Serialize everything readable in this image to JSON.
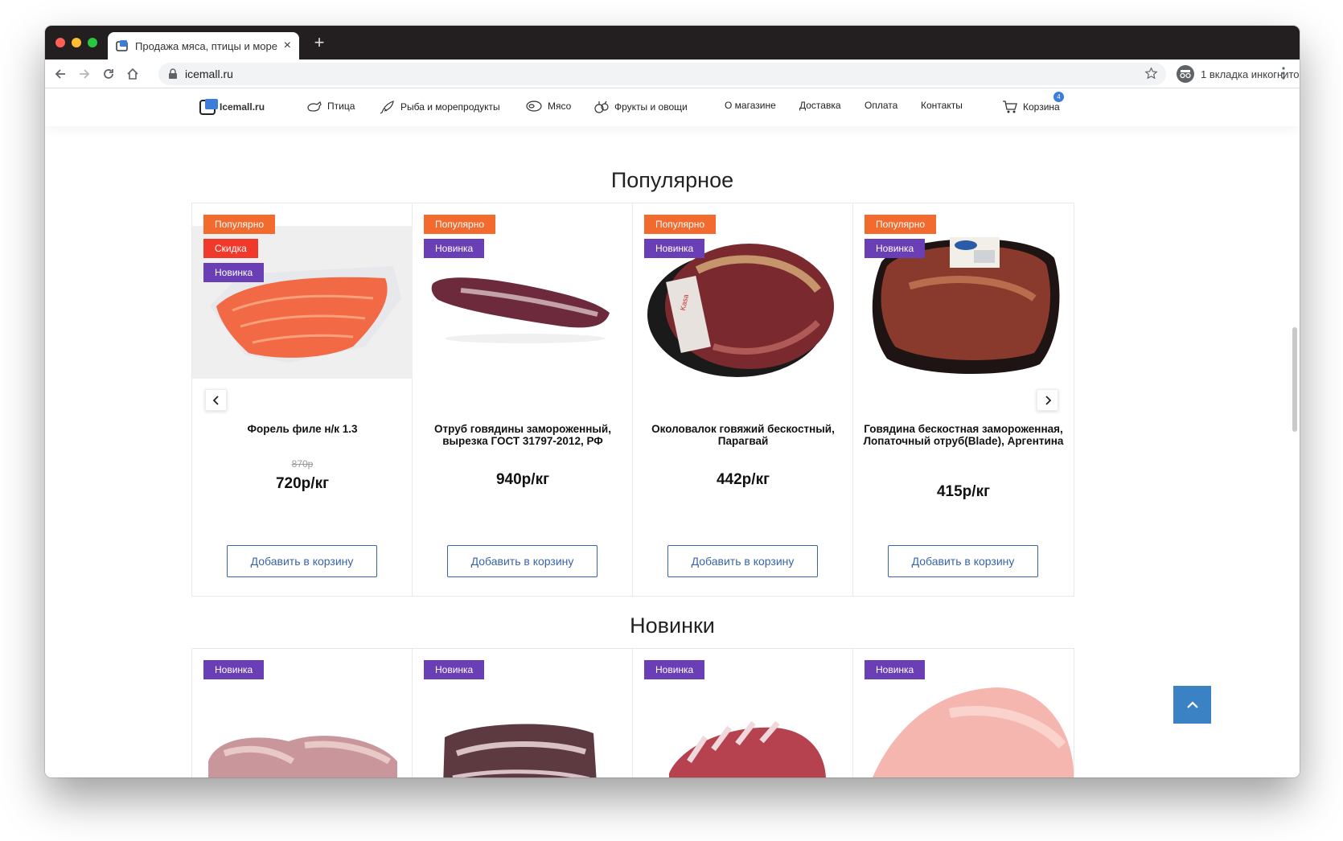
{
  "browser": {
    "tab_title": "Продажа мяса, птицы и море",
    "tab_close": "×",
    "new_tab": "+",
    "url": "icemall.ru",
    "incognito_label": "1 вкладка инкогнито"
  },
  "site": {
    "logo_text": "Icemall.ru",
    "nav": [
      {
        "label": "Птица",
        "icon": "poultry-icon"
      },
      {
        "label": "Рыба и морепродукты",
        "icon": "fish-icon"
      },
      {
        "label": "Мясо",
        "icon": "meat-icon"
      },
      {
        "label": "Фрукты и овощи",
        "icon": "fruits-icon"
      },
      {
        "label": "О магазине"
      },
      {
        "label": "Доставка"
      },
      {
        "label": "Оплата"
      },
      {
        "label": "Контакты"
      }
    ],
    "cart_label": "Корзина",
    "cart_count": "4"
  },
  "popular": {
    "title": "Популярное",
    "products": [
      {
        "name": "Форель филе н/к 1.3",
        "old_price": "870р",
        "price": "720р/кг",
        "badges": [
          "Популярно",
          "Скидка",
          "Новинка"
        ],
        "button": "Добавить в корзину"
      },
      {
        "name": "Отруб говядины замороженный, вырезка ГОСТ 31797-2012, РФ",
        "price": "940р/кг",
        "badges": [
          "Популярно",
          "Новинка"
        ],
        "button": "Добавить в корзину"
      },
      {
        "name": "Околовалок говяжий бескостный, Парагвай",
        "price": "442р/кг",
        "badges": [
          "Популярно",
          "Новинка"
        ],
        "button": "Добавить в корзину"
      },
      {
        "name": "Говядина бескостная замороженная, Лопаточный отруб(Blade), Аргентина",
        "price": "415р/кг",
        "badges": [
          "Популярно",
          "Новинка"
        ],
        "button": "Добавить в корзину"
      }
    ]
  },
  "new_items": {
    "title": "Новинки",
    "products": [
      {
        "badges": [
          "Новинка"
        ]
      },
      {
        "badges": [
          "Новинка"
        ]
      },
      {
        "badges": [
          "Новинка"
        ]
      },
      {
        "badges": [
          "Новинка"
        ]
      }
    ]
  },
  "colors": {
    "badge_popular": "#f26a2e",
    "badge_sale": "#f0392b",
    "badge_new": "#6a3fb5",
    "accent": "#3a63a8",
    "scroll_top": "#3b82c4"
  }
}
